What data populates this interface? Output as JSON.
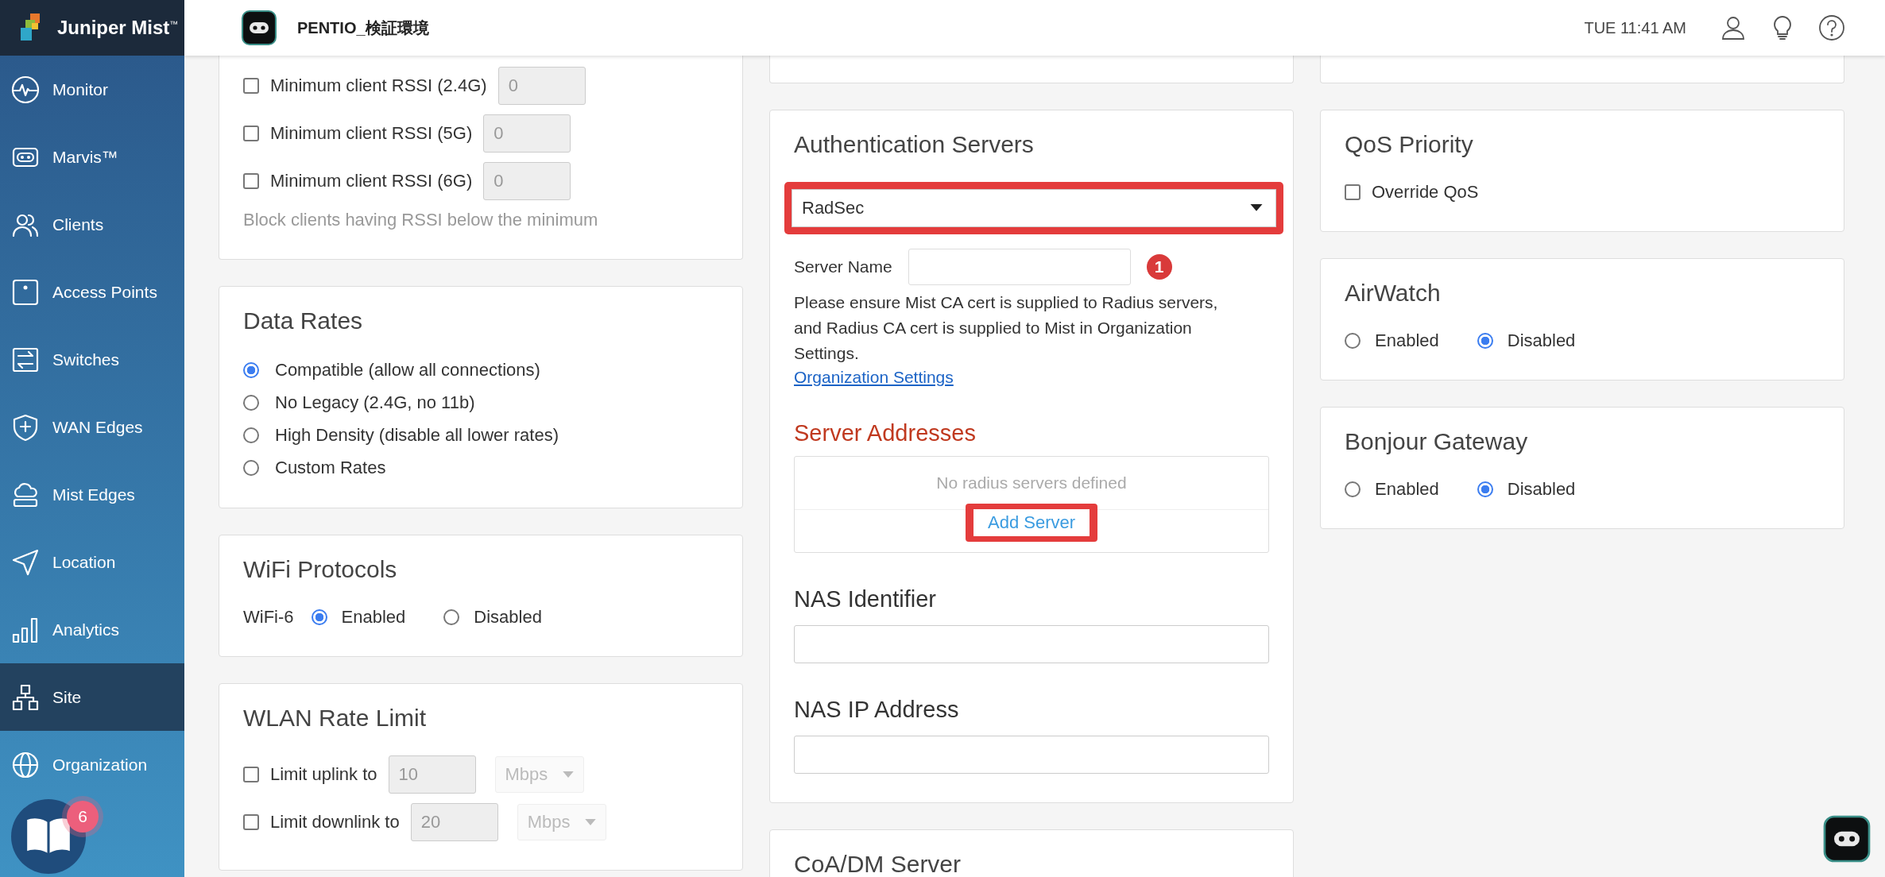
{
  "brand": {
    "name": "Juniper Mist",
    "mark": "™"
  },
  "header": {
    "site": "PENTIO_検証環境",
    "clock": "TUE 11:41 AM"
  },
  "sidebar": {
    "items": [
      {
        "label": "Monitor",
        "selected": false
      },
      {
        "label": "Marvis™",
        "selected": false
      },
      {
        "label": "Clients",
        "selected": false
      },
      {
        "label": "Access Points",
        "selected": false
      },
      {
        "label": "Switches",
        "selected": false
      },
      {
        "label": "WAN Edges",
        "selected": false
      },
      {
        "label": "Mist Edges",
        "selected": false
      },
      {
        "label": "Location",
        "selected": false
      },
      {
        "label": "Analytics",
        "selected": false
      },
      {
        "label": "Site",
        "selected": true
      },
      {
        "label": "Organization",
        "selected": false
      }
    ]
  },
  "help": {
    "badge": "6"
  },
  "columns": [
    [
      {
        "clipped": true,
        "rows": [
          {
            "kind": "check_field",
            "label": "Minimum client RSSI (2.4G)",
            "checked": false,
            "value": "0"
          },
          {
            "kind": "check_field",
            "label": "Minimum client RSSI (5G)",
            "checked": false,
            "value": "0"
          },
          {
            "kind": "check_field",
            "label": "Minimum client RSSI (6G)",
            "checked": false,
            "value": "0"
          },
          {
            "kind": "note",
            "text": "Block clients having RSSI below the minimum"
          }
        ]
      },
      {
        "clipped": false,
        "title": "Data Rates",
        "rows": [
          {
            "kind": "radio",
            "label": "Compatible (allow all connections)",
            "selected": true
          },
          {
            "kind": "radio",
            "label": "No Legacy (2.4G, no 11b)",
            "selected": false
          },
          {
            "kind": "radio",
            "label": "High Density (disable all lower rates)",
            "selected": false
          },
          {
            "kind": "radio",
            "label": "Custom Rates",
            "selected": false
          }
        ]
      },
      {
        "clipped": false,
        "title": "WiFi Protocols",
        "rows": [
          {
            "kind": "radio_group",
            "label": "WiFi-6",
            "options": [
              {
                "label": "Enabled",
                "selected": true
              },
              {
                "label": "Disabled",
                "selected": false
              }
            ]
          }
        ]
      },
      {
        "clipped": false,
        "title": "WLAN Rate Limit",
        "rows": [
          {
            "kind": "check_field",
            "label": "Limit uplink to",
            "checked": false,
            "value": "10",
            "unit": "Mbps"
          },
          {
            "kind": "check_field",
            "label": "Limit downlink to",
            "checked": false,
            "value": "20",
            "unit": "Mbps"
          }
        ]
      }
    ],
    [
      {
        "clipped": true
      },
      {
        "clipped": false,
        "title": "Authentication Servers",
        "rows": [
          {
            "kind": "select",
            "value": "RadSec",
            "highlighted": true
          },
          {
            "kind": "labeled_field",
            "label": "Server Name",
            "step": "1"
          },
          {
            "kind": "paragraph",
            "text": "Please ensure Mist CA cert is supplied to Radius servers, and Radius CA cert is supplied to Mist in Organization Settings."
          },
          {
            "kind": "link",
            "text": "Organization Settings"
          },
          {
            "kind": "subheading",
            "text": "Server Addresses"
          },
          {
            "kind": "list_box",
            "empty_text": "No radius servers defined",
            "action": {
              "label": "Add Server",
              "highlighted": true
            }
          },
          {
            "kind": "field",
            "label": "NAS Identifier"
          },
          {
            "kind": "field",
            "label": "NAS IP Address"
          }
        ]
      },
      {
        "clipped": false,
        "title": "CoA/DM Server"
      }
    ],
    [
      {
        "clipped": true
      },
      {
        "clipped": false,
        "title": "QoS Priority",
        "rows": [
          {
            "kind": "check",
            "label": "Override QoS",
            "checked": false
          }
        ]
      },
      {
        "clipped": false,
        "title": "AirWatch",
        "rows": [
          {
            "kind": "radio_group",
            "options": [
              {
                "label": "Enabled",
                "selected": false
              },
              {
                "label": "Disabled",
                "selected": true
              }
            ]
          }
        ]
      },
      {
        "clipped": false,
        "title": "Bonjour Gateway",
        "rows": [
          {
            "kind": "radio_group",
            "options": [
              {
                "label": "Enabled",
                "selected": false
              },
              {
                "label": "Disabled",
                "selected": true
              }
            ]
          }
        ]
      }
    ]
  ]
}
